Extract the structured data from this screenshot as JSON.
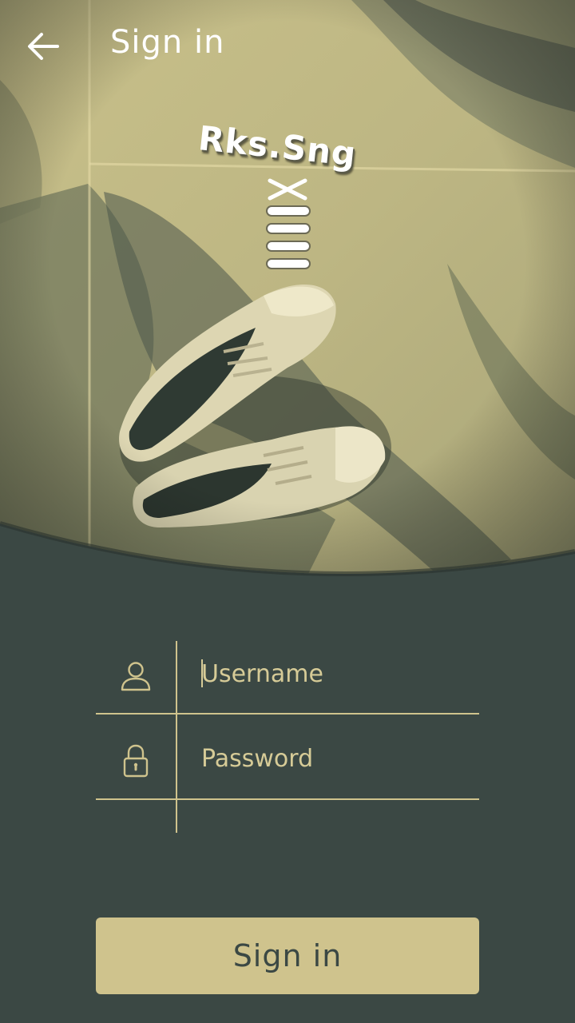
{
  "header": {
    "title": "Sign in",
    "back_icon": "arrow-left-icon"
  },
  "hero": {
    "logo_text": "Rks.Sng",
    "logo_icon": "shoelace-icon",
    "image": "sneakers-on-marble-photo"
  },
  "form": {
    "username": {
      "placeholder": "Username",
      "value": "",
      "icon": "user-icon"
    },
    "password": {
      "placeholder": "Password",
      "value": "",
      "icon": "lock-icon"
    }
  },
  "actions": {
    "sign_in_label": "Sign in"
  },
  "colors": {
    "background": "#3b4844",
    "accent": "#cfc38d",
    "text_on_accent": "#3b4844",
    "field_text": "#d6cb97"
  }
}
